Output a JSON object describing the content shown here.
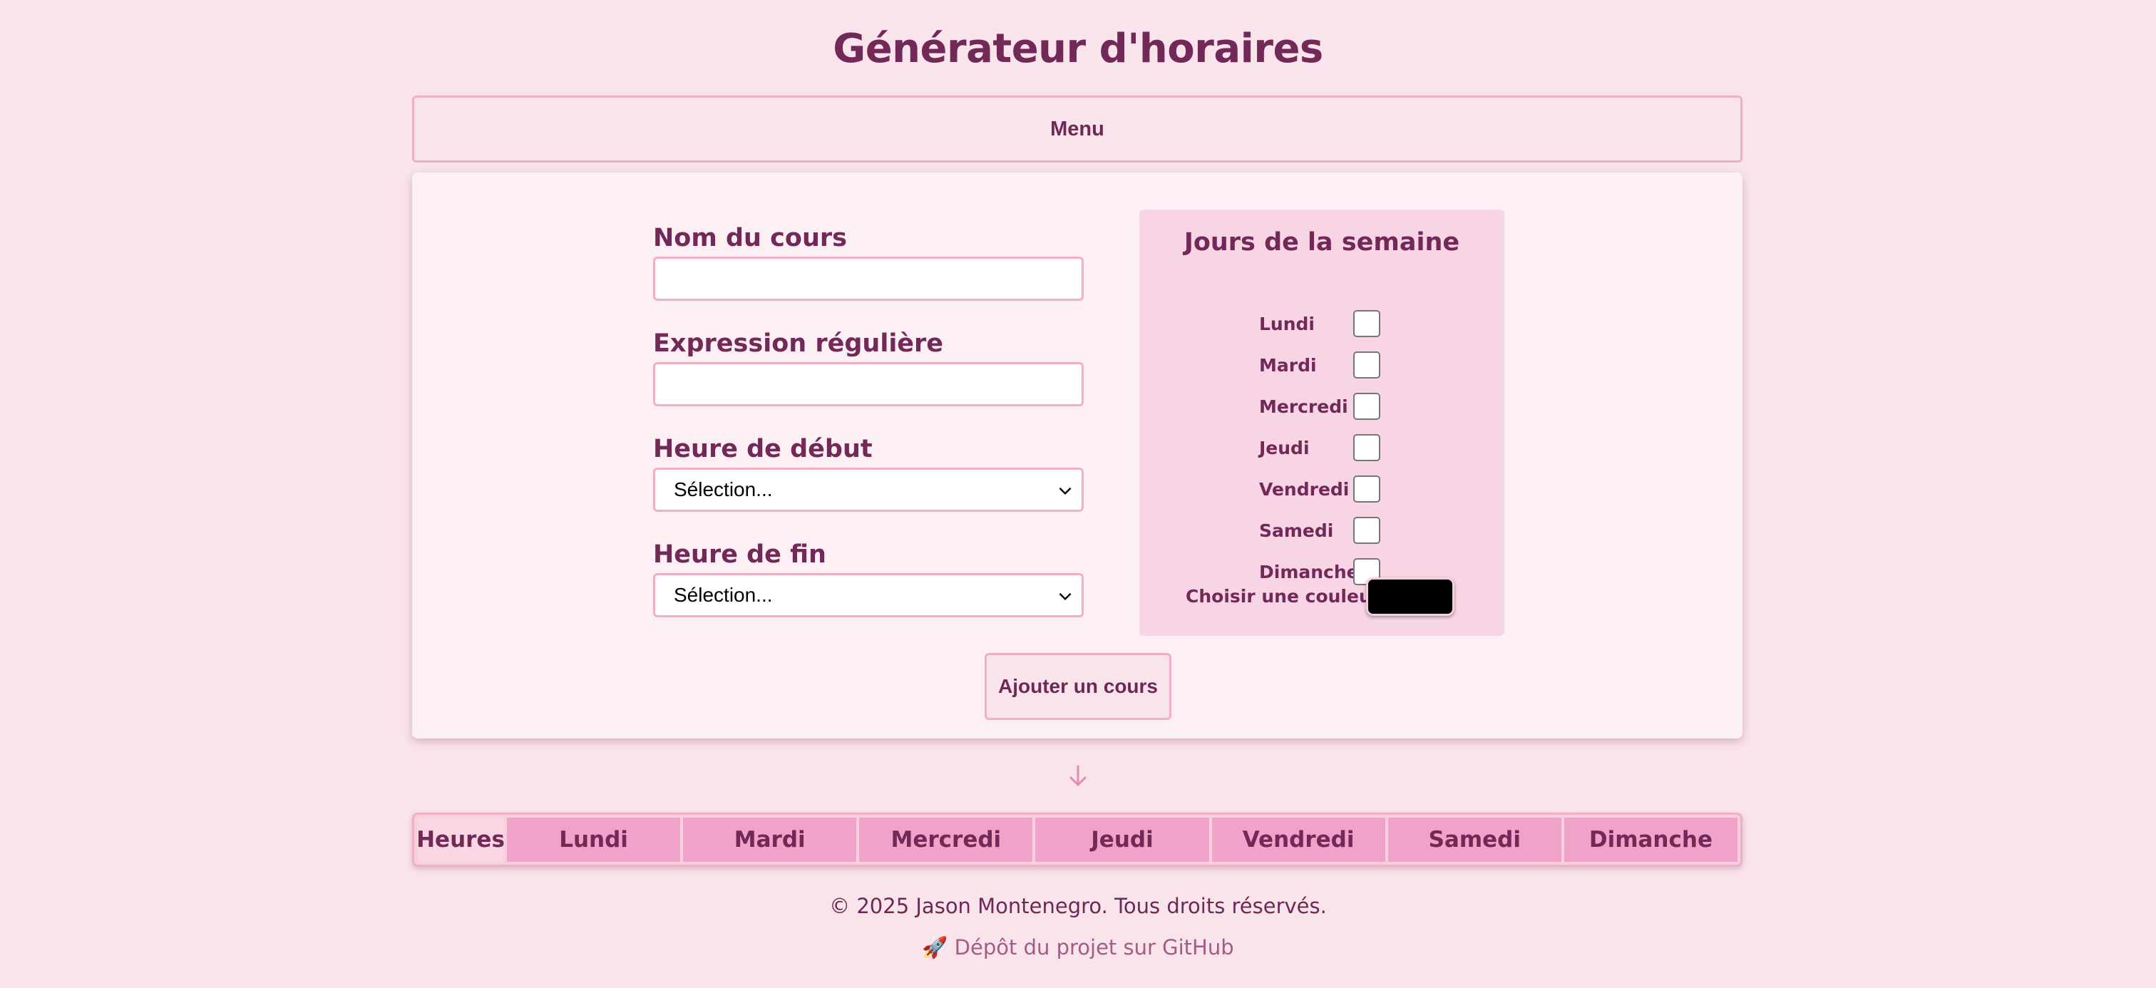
{
  "page": {
    "title": "Générateur d'horaires"
  },
  "menu": {
    "label": "Menu"
  },
  "form": {
    "course_name_label": "Nom du cours",
    "course_name_value": "",
    "regex_label": "Expression régulière",
    "regex_value": "",
    "start_time_label": "Heure de début",
    "start_time_value": "Sélection...",
    "end_time_label": "Heure de fin",
    "end_time_value": "Sélection...",
    "add_button_label": "Ajouter un cours"
  },
  "days_panel": {
    "title": "Jours de la semaine",
    "days": [
      {
        "label": "Lundi",
        "checked": false
      },
      {
        "label": "Mardi",
        "checked": false
      },
      {
        "label": "Mercredi",
        "checked": false
      },
      {
        "label": "Jeudi",
        "checked": false
      },
      {
        "label": "Vendredi",
        "checked": false
      },
      {
        "label": "Samedi",
        "checked": false
      },
      {
        "label": "Dimanche",
        "checked": false
      }
    ],
    "color_label": "Choisir une couleur",
    "color_value": "#000000"
  },
  "schedule": {
    "headers": [
      "Heures",
      "Lundi",
      "Mardi",
      "Mercredi",
      "Jeudi",
      "Vendredi",
      "Samedi",
      "Dimanche"
    ]
  },
  "footer": {
    "copyright": "© 2025 Jason Montenegro. Tous droits réservés.",
    "repo_link": "🚀 Dépôt du projet sur GitHub"
  },
  "icons": {
    "scroll_arrow": "arrow-down-icon",
    "select_chevron": "chevron-down-icon"
  },
  "colors": {
    "background": "#fae4eb",
    "accent": "#f0a2c9",
    "text": "#722958",
    "border": "#f1afc5"
  }
}
